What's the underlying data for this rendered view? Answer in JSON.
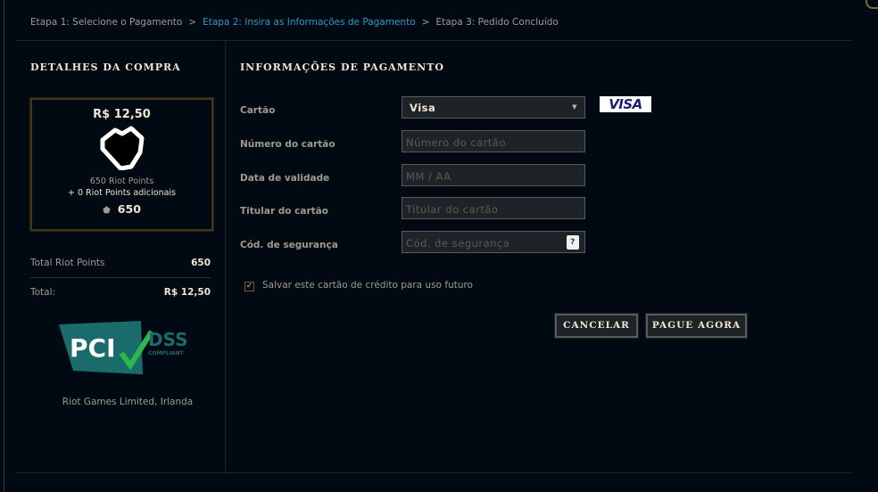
{
  "breadcrumb": {
    "step1": "Etapa 1: Selecione o Pagamento",
    "step2": "Etapa 2: Insira as Informações de Pagamento",
    "step3": "Etapa 3: Pedido Concluído",
    "separator": ">"
  },
  "left": {
    "title": "DETALHES DA COMPRA",
    "card": {
      "price": "R$ 12,50",
      "points": "650 Riot Points",
      "bonus": "+ 0 Riot Points adicionais",
      "total_points": "650"
    },
    "total_rp_label": "Total Riot Points",
    "total_rp_value": "650",
    "total_label": "Total:",
    "total_value": "R$ 12,50",
    "pci_logo": {
      "main": "PCI",
      "dss": "DSS",
      "compliant": "COMPLIANT"
    },
    "company": "Riot Games Limited, Irlanda"
  },
  "right": {
    "title": "INFORMAÇÕES DE PAGAMENTO",
    "labels": {
      "card": "Cartão",
      "number": "Número do cartão",
      "expiry": "Data de validade",
      "holder": "Titular do cartão",
      "cvv": "Cód. de segurança"
    },
    "card_type": "Visa",
    "card_brand_logo": "VISA",
    "placeholders": {
      "number": "Número do cartão",
      "expiry": "MM / AA",
      "holder": "Titular do cartão",
      "cvv": "Cód. de segurança"
    },
    "help": "?",
    "save_card": {
      "label": "Salvar este cartão de crédito para uso futuro",
      "checked": true
    },
    "cancel": "CANCELAR",
    "pay": "PAGUE AGORA"
  }
}
